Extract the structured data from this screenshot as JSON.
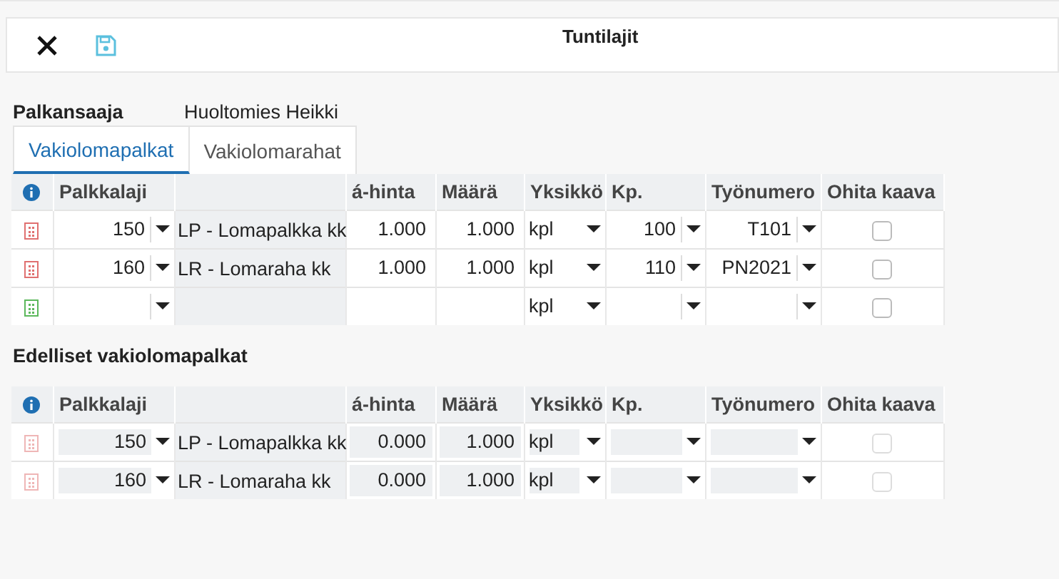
{
  "toolbar": {
    "title": "Tuntilajit"
  },
  "employee": {
    "label": "Palkansaaja",
    "value": "Huoltomies Heikki"
  },
  "tabs": [
    {
      "label": "Vakiolomapalkat",
      "selected": true
    },
    {
      "label": "Vakiolomarahat",
      "selected": false
    }
  ],
  "tables": [
    {
      "disabled": false,
      "columns": {
        "palkkalaji": "Palkkalaji",
        "a_hinta": "á-hinta",
        "maara": "Määrä",
        "yksikko": "Yksikkö",
        "kp": "Kp.",
        "tyonumero": "Työnumero",
        "ohita": "Ohita kaava"
      },
      "rows": [
        {
          "kind": "existing",
          "palkkalaji": "150",
          "name": "LP - Lomapalkka kk",
          "a_hinta": "1.000",
          "maara": "1.000",
          "yksikko": "kpl",
          "kp": "100",
          "tyonumero": "T101",
          "ohita": false
        },
        {
          "kind": "existing",
          "palkkalaji": "160",
          "name": "LR - Lomaraha kk",
          "a_hinta": "1.000",
          "maara": "1.000",
          "yksikko": "kpl",
          "kp": "110",
          "tyonumero": "PN2021",
          "ohita": false
        },
        {
          "kind": "new",
          "yksikko": "kpl",
          "ohita": false
        }
      ]
    },
    {
      "heading": "Edelliset vakiolomapalkat",
      "disabled": true,
      "columns": {
        "palkkalaji": "Palkkalaji",
        "a_hinta": "á-hinta",
        "maara": "Määrä",
        "yksikko": "Yksikkö",
        "kp": "Kp.",
        "tyonumero": "Työnumero",
        "ohita": "Ohita kaava"
      },
      "rows": [
        {
          "kind": "existing",
          "palkkalaji": "150",
          "name": "LP - Lomapalkka kk",
          "a_hinta": "0.000",
          "maara": "1.000",
          "yksikko": "kpl",
          "ohita": false
        },
        {
          "kind": "existing",
          "palkkalaji": "160",
          "name": "LR - Lomaraha kk",
          "a_hinta": "0.000",
          "maara": "1.000",
          "yksikko": "kpl",
          "ohita": false
        }
      ]
    }
  ]
}
